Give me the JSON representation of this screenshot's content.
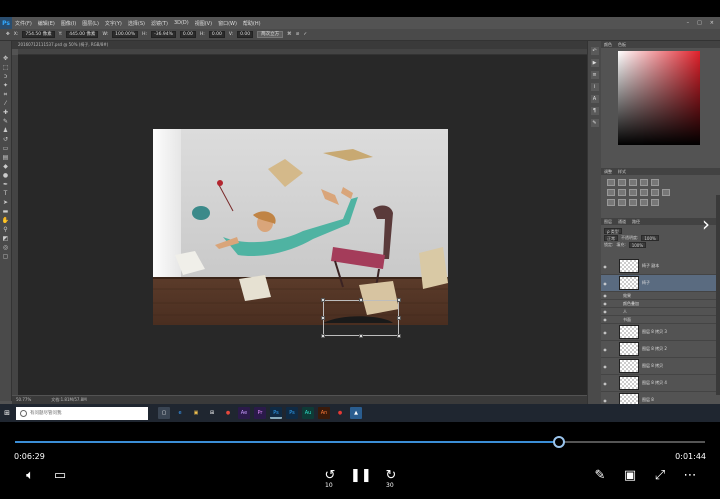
{
  "photoshop": {
    "logo": "Ps",
    "menu": [
      "文件(F)",
      "编辑(E)",
      "图像(I)",
      "图层(L)",
      "文字(Y)",
      "选择(S)",
      "滤镜(T)",
      "3D(D)",
      "视图(V)",
      "窗口(W)",
      "帮助(H)"
    ],
    "options": {
      "x_value": "754.50 像素",
      "y_value": "445.00 像素",
      "w_value": "100.00%",
      "h_value": "-36.94%",
      "angle_value": "0.00",
      "hskew_value": "0.00",
      "vskew_value": "0.00",
      "interp_label": "两次立方"
    },
    "document_tab": "20160712111537.psd @ 50% (椅子, RGB/8#)",
    "status": {
      "zoom": "50.77%",
      "doc_info": "文档:1.81M/57.8M"
    },
    "panels": {
      "adjust_tabs": [
        "调整",
        "样式"
      ],
      "layer_tabs": [
        "图层",
        "通道",
        "路径"
      ],
      "blend_mode": "正常",
      "opacity_label": "不透明度:",
      "opacity_value": "100%",
      "fill_label": "填充:",
      "fill_value": "100%",
      "layers": [
        {
          "name": "椅子 副本",
          "selected": false,
          "thumb": true
        },
        {
          "name": "椅子",
          "selected": true,
          "thumb": true
        },
        {
          "name": "效果",
          "selected": false,
          "thumb": false
        },
        {
          "name": "颜色叠加",
          "selected": false,
          "thumb": false
        },
        {
          "name": "人",
          "selected": false,
          "thumb": false
        },
        {
          "name": "书面",
          "selected": false,
          "thumb": false
        },
        {
          "name": "图层 8 拷贝 3",
          "selected": false,
          "thumb": true
        },
        {
          "name": "图层 8 拷贝 2",
          "selected": false,
          "thumb": true
        },
        {
          "name": "图层 8 拷贝",
          "selected": false,
          "thumb": true
        },
        {
          "name": "图层 8 拷贝 4",
          "selected": false,
          "thumb": true
        },
        {
          "name": "图层 8",
          "selected": false,
          "thumb": true
        }
      ]
    }
  },
  "taskbar": {
    "search_placeholder": "有问题尽管问我",
    "apps": [
      "e",
      "▣",
      "⊞",
      "●",
      "Ae",
      "Pr",
      "Ps",
      "Ps",
      "Au",
      "An",
      "●",
      "▲"
    ]
  },
  "player": {
    "elapsed": "0:06:29",
    "remaining": "0:01:44",
    "progress": 0.788,
    "skip_back_label": "10",
    "skip_forward_label": "30"
  }
}
